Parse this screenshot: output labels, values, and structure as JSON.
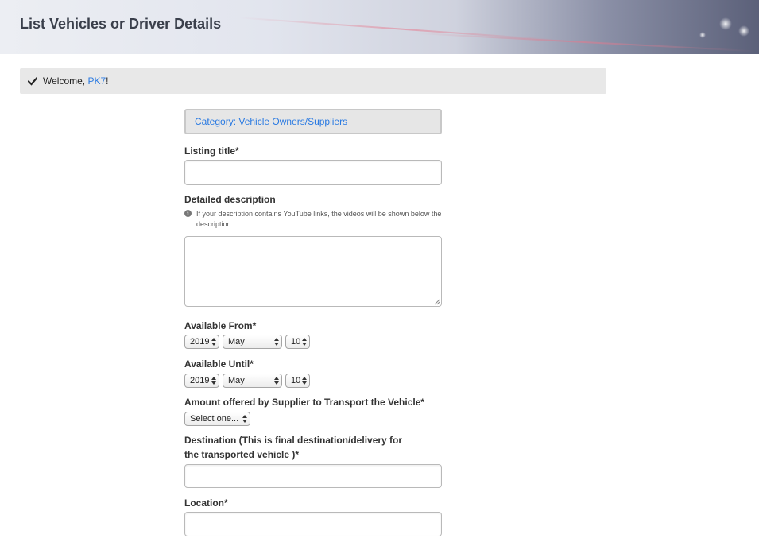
{
  "header": {
    "title": "List Vehicles or Driver Details"
  },
  "welcome": {
    "prefix": "Welcome, ",
    "username": "PK7",
    "suffix": "!",
    "icon": "check-icon"
  },
  "form": {
    "category": "Category: Vehicle Owners/Suppliers",
    "listing_title": {
      "label": "Listing title*",
      "value": ""
    },
    "description": {
      "label": "Detailed description",
      "hint": "If your description contains YouTube links, the videos will be shown below the description.",
      "hint_icon": "info-icon",
      "value": ""
    },
    "available_from": {
      "label": "Available From*",
      "year": "2019",
      "month": "May",
      "day": "10"
    },
    "available_until": {
      "label": "Available Until*",
      "year": "2019",
      "month": "May",
      "day": "10"
    },
    "amount": {
      "label": "Amount offered by Supplier to Transport the Vehicle*",
      "selected": "Select one..."
    },
    "destination": {
      "label": "Destination (This is final destination/delivery for the transported vehicle )*",
      "value": ""
    },
    "location": {
      "label": "Location*",
      "value": ""
    }
  }
}
